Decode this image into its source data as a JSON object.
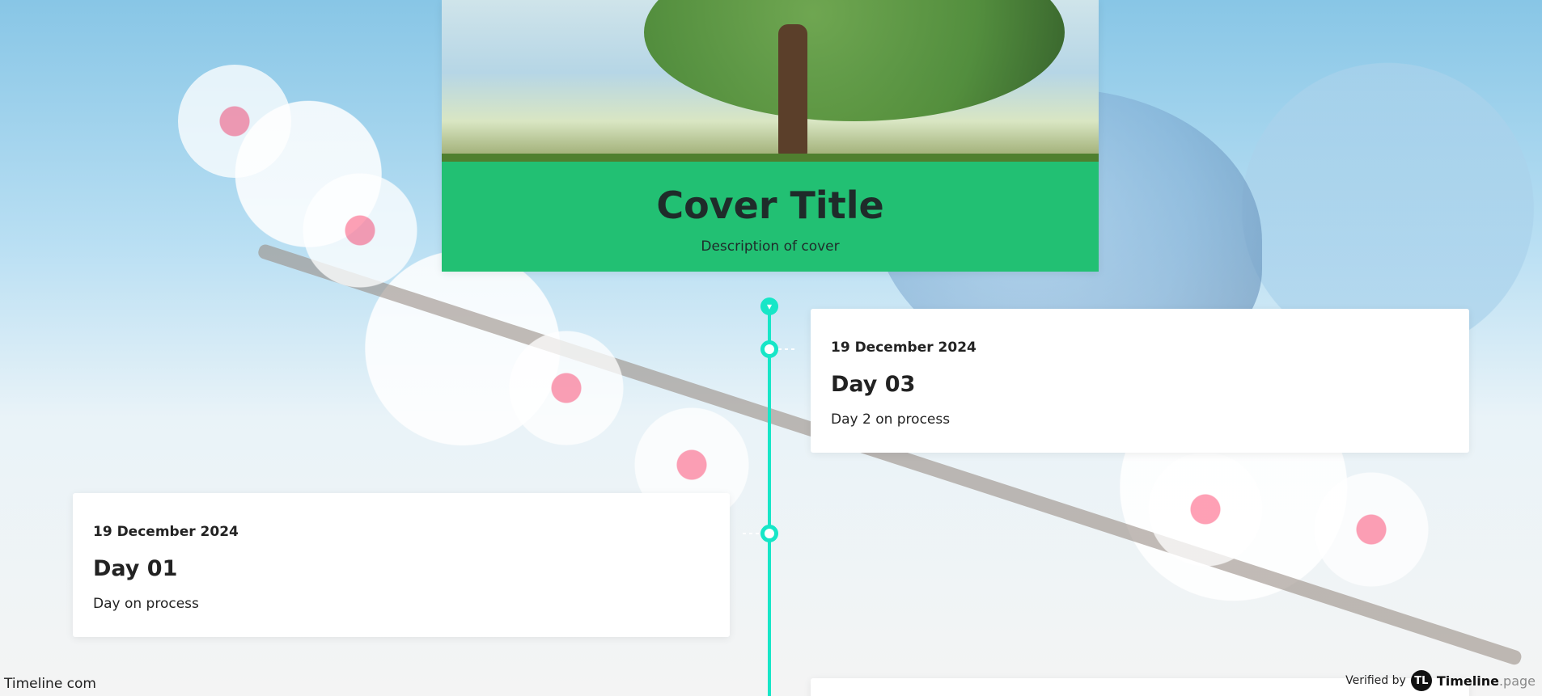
{
  "cover": {
    "title": "Cover Title",
    "description": "Description of cover"
  },
  "timeline": {
    "events": [
      {
        "side": "right",
        "date": "19 December 2024",
        "title": "Day 03",
        "description": "Day 2 on process"
      },
      {
        "side": "left",
        "date": "19 December 2024",
        "title": "Day 01",
        "description": "Day on process"
      }
    ],
    "colors": {
      "accent": "#17E6C7",
      "cover": "#22C073"
    }
  },
  "footer": {
    "left_text": "Timeline com",
    "verified_label": "Verified by",
    "brand_logo_text": "TL",
    "brand_name": "Timeline",
    "brand_suffix": ".page"
  }
}
